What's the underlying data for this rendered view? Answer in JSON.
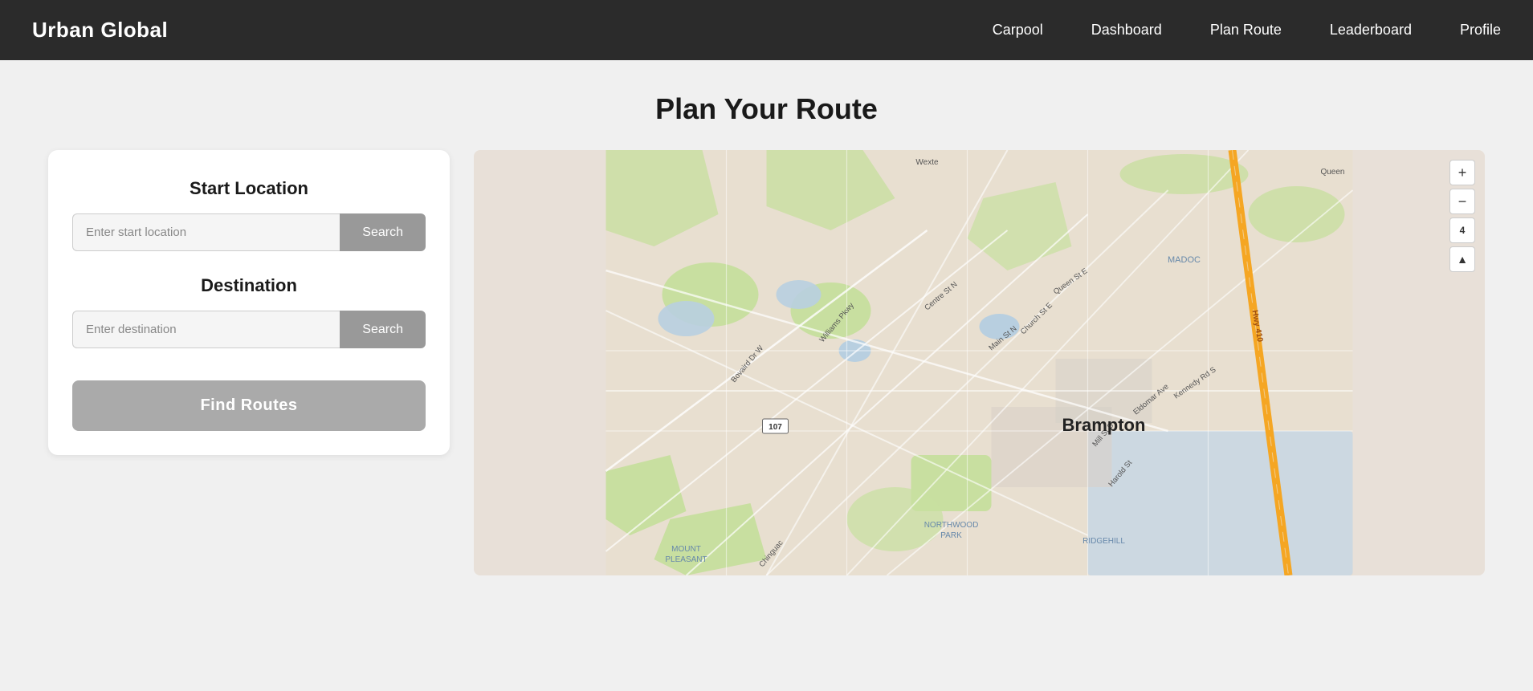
{
  "navbar": {
    "brand": "Urban Global",
    "links": [
      {
        "id": "carpool",
        "label": "Carpool",
        "active": false
      },
      {
        "id": "dashboard",
        "label": "Dashboard",
        "active": false
      },
      {
        "id": "plan-route",
        "label": "Plan Route",
        "active": true
      },
      {
        "id": "leaderboard",
        "label": "Leaderboard",
        "active": false
      },
      {
        "id": "profile",
        "label": "Profile",
        "active": false
      }
    ]
  },
  "page": {
    "title": "Plan Your Route"
  },
  "form": {
    "start_location_label": "Start Location",
    "start_input_placeholder": "Enter start location",
    "start_search_label": "Search",
    "destination_label": "Destination",
    "destination_input_placeholder": "Enter destination",
    "destination_search_label": "Search",
    "find_routes_label": "Find Routes"
  },
  "map": {
    "zoom_in": "+",
    "zoom_out": "−",
    "zoom_level": "4",
    "compass": "▲",
    "city_label": "Brampton",
    "labels": [
      "MADOC",
      "RIDGEHILL",
      "NORTHWOOD PARK",
      "MOUNT PLEASANT",
      "Wexte",
      "Bovaird Dr W",
      "Williams Pkwy",
      "Centre St N",
      "Queen St E",
      "Church St E",
      "Main St N",
      "Kennedy Rd S",
      "Eldomar Ave",
      "Mill St S",
      "Harold St",
      "Hwy 410",
      "107",
      "107",
      "Chinguac"
    ]
  },
  "colors": {
    "navbar_bg": "#2b2b2b",
    "brand_text": "#ffffff",
    "nav_link": "#ffffff",
    "page_bg": "#f0f0f0",
    "panel_bg": "#ffffff",
    "btn_search": "#999999",
    "btn_find": "#aaaaaa",
    "map_road_major": "#f5a623",
    "map_road_minor": "#ffffff",
    "map_bg": "#e8dfd0",
    "map_water": "#b8cfe0",
    "map_green": "#c8dfa0"
  }
}
